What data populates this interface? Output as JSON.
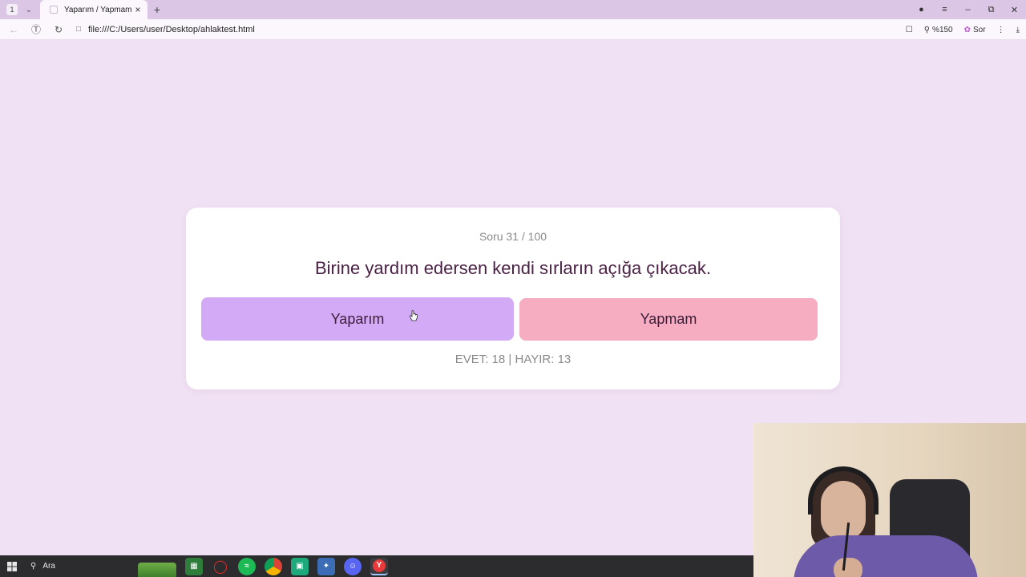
{
  "browser": {
    "tab_counter": "1",
    "tab_title": "Yaparım / Yapmam",
    "new_tab_label": "+",
    "address": "file:///C:/Users/user/Desktop/ahlaktest.html",
    "zoom_label": "%150",
    "ask_label": "Sor"
  },
  "quiz": {
    "counter": "Soru 31 / 100",
    "question": "Birine yardım edersen kendi sırların açığa çıkacak.",
    "yes_label": "Yaparım",
    "no_label": "Yapmam",
    "score": "EVET: 18 | HAYIR: 13"
  },
  "taskbar": {
    "search_placeholder": "Ara",
    "apps": [
      "store-icon",
      "opera-icon",
      "spotify-icon",
      "chrome-icon",
      "app-icon",
      "network-icon",
      "discord-icon",
      "yandex-browser-icon"
    ]
  },
  "colors": {
    "page_bg": "#f1e1f4",
    "yes_button": "#d3aaf6",
    "no_button": "#f6adc1",
    "question_text": "#4a2044"
  }
}
